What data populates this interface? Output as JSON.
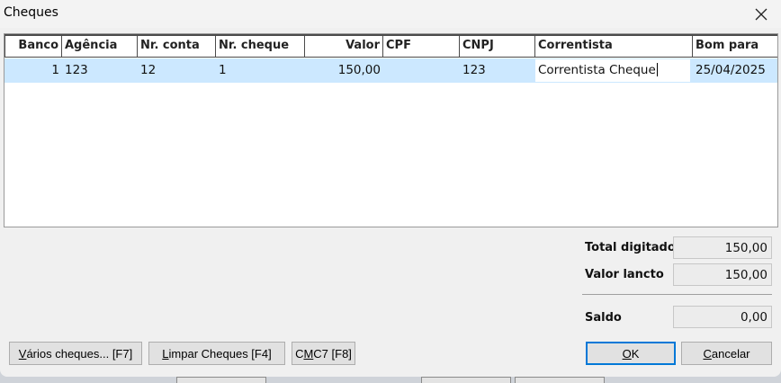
{
  "window": {
    "title": "Cheques"
  },
  "grid": {
    "columns": [
      "Banco",
      "Agência",
      "Nr. conta",
      "Nr. cheque",
      "Valor",
      "CPF",
      "CNPJ",
      "Correntista",
      "Bom para"
    ],
    "rows": [
      {
        "banco": "1",
        "agencia": "123",
        "conta": "12",
        "cheque": "1",
        "valor": "150,00",
        "cpf": "",
        "cnpj": "123",
        "correntista": "Correntista Cheque",
        "bom_para": "25/04/2025"
      }
    ]
  },
  "totals": {
    "total_digitado_label": "Total digitado",
    "total_digitado": "150,00",
    "valor_lancto_label": "Valor lancto",
    "valor_lancto": "150,00",
    "saldo_label": "Saldo",
    "saldo": "0,00"
  },
  "buttons": {
    "varios": {
      "mn": "V",
      "rest": "ários cheques... [F7]"
    },
    "limpar": {
      "mn": "L",
      "rest": "impar Cheques [F4]"
    },
    "cmc7": {
      "pre": "C",
      "mn": "M",
      "rest": "C7 [F8]"
    },
    "ok": {
      "mn": "O",
      "rest": "K"
    },
    "cancelar": {
      "mn": "C",
      "rest": "ancelar"
    }
  }
}
